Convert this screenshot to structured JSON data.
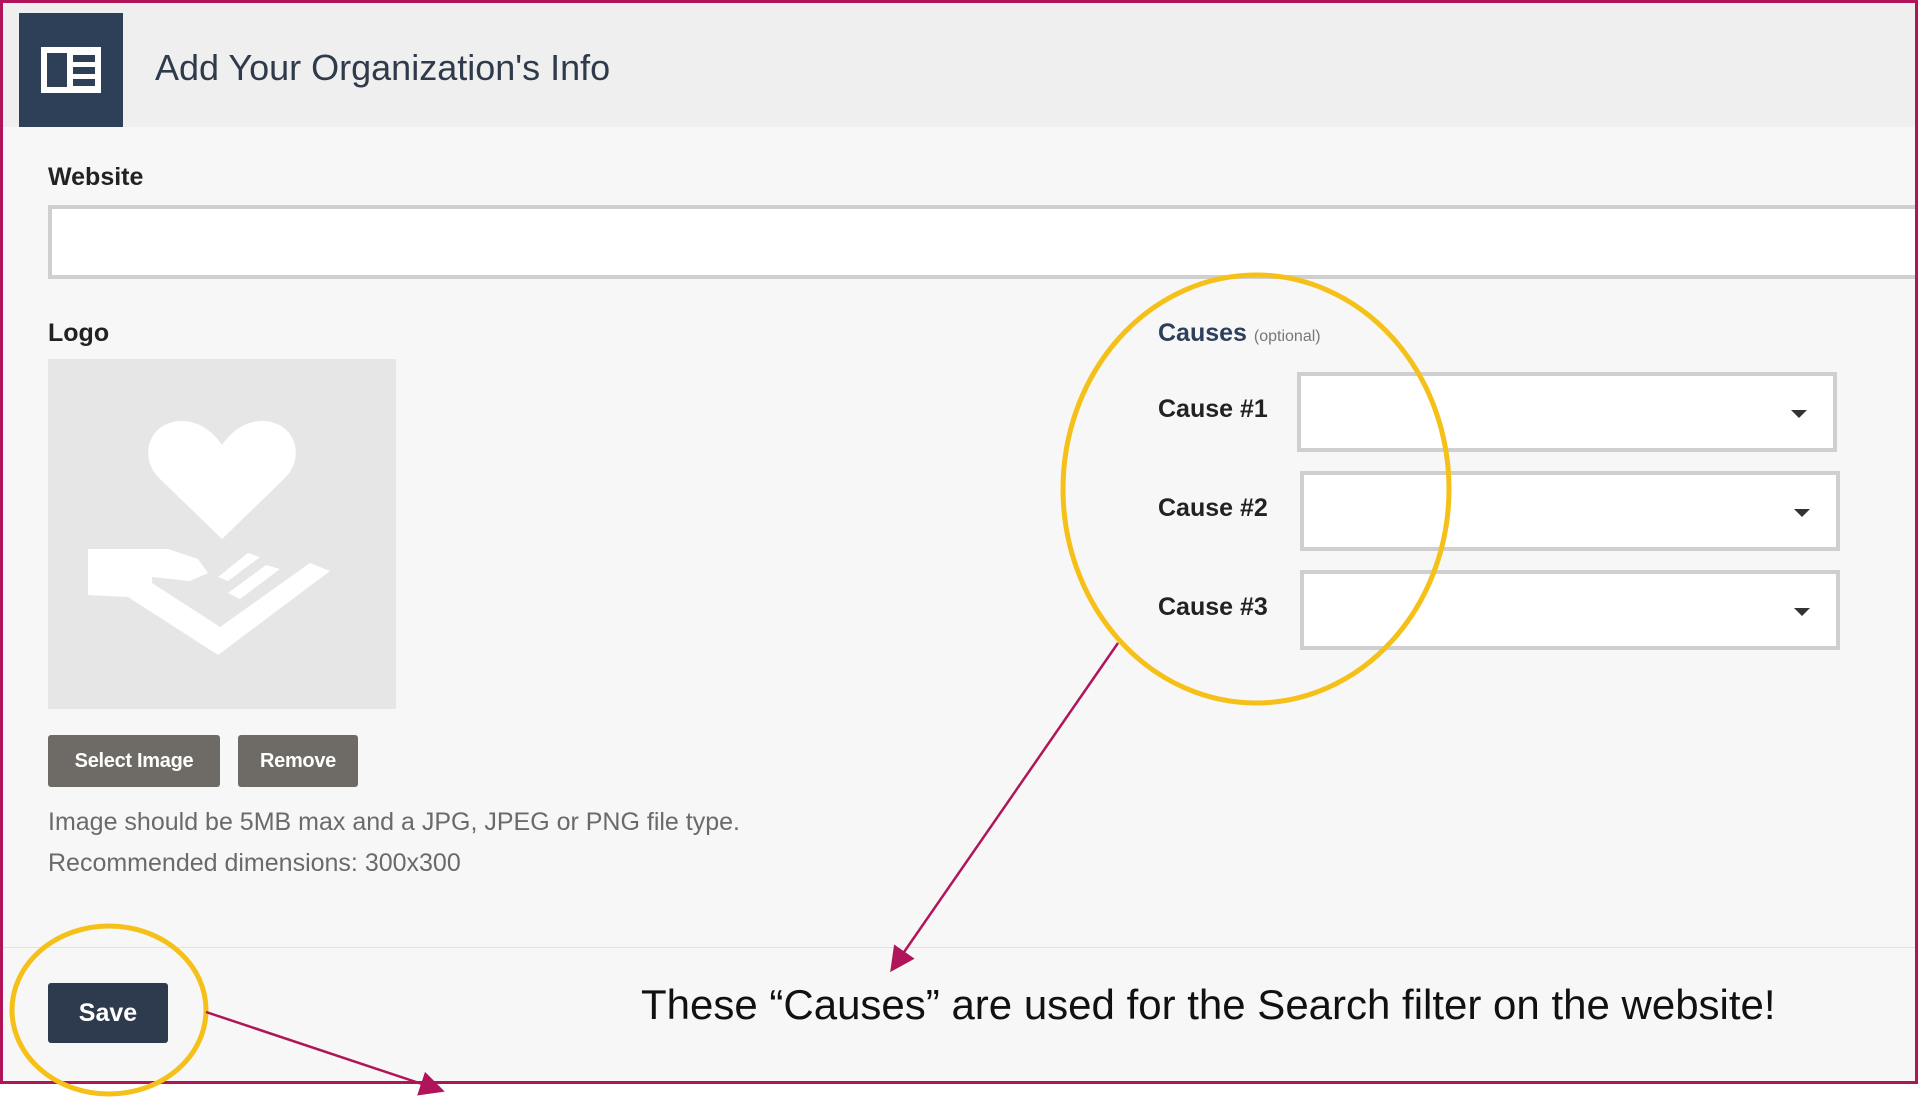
{
  "header": {
    "title": "Add Your Organization's Info",
    "icon": "layout-card-icon"
  },
  "form": {
    "website_label": "Website",
    "website_value": "",
    "logo_label": "Logo",
    "logo_placeholder_icon": "heart-hand-icon",
    "select_image_label": "Select Image",
    "remove_label": "Remove",
    "help_line1": "Image should be 5MB max and a JPG, JPEG or PNG file type.",
    "help_line2": "Recommended dimensions: 300x300",
    "causes_title": "Causes",
    "causes_optional": "(optional)",
    "causes": [
      {
        "label": "Cause #1",
        "value": ""
      },
      {
        "label": "Cause #2",
        "value": ""
      },
      {
        "label": "Cause #3",
        "value": ""
      }
    ],
    "save_label": "Save"
  },
  "annotation": {
    "note": "These “Causes” are used for the Search filter on the website!",
    "highlight_color": "#f5c018",
    "arrow_color": "#b0155a"
  }
}
